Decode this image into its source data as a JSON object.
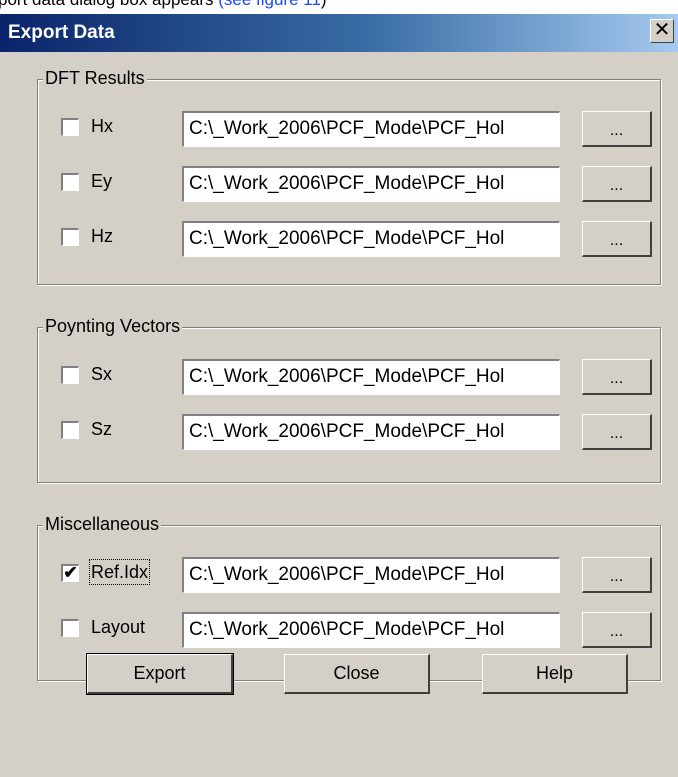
{
  "doc": {
    "text_before": "port data dialog box appears ",
    "link_text": "(see figure 11",
    "text_after": ")"
  },
  "window": {
    "title": "Export Data",
    "close_label": "✕"
  },
  "groups": {
    "dft": {
      "label": "DFT Results",
      "rows": [
        {
          "label": "Hx",
          "checked": false,
          "path": "C:\\_Work_2006\\PCF_Mode\\PCF_Hol",
          "browse": "..."
        },
        {
          "label": "Ey",
          "checked": false,
          "path": "C:\\_Work_2006\\PCF_Mode\\PCF_Hol",
          "browse": "..."
        },
        {
          "label": "Hz",
          "checked": false,
          "path": "C:\\_Work_2006\\PCF_Mode\\PCF_Hol",
          "browse": "..."
        }
      ]
    },
    "poynting": {
      "label": "Poynting Vectors",
      "rows": [
        {
          "label": "Sx",
          "checked": false,
          "path": "C:\\_Work_2006\\PCF_Mode\\PCF_Hol",
          "browse": "..."
        },
        {
          "label": "Sz",
          "checked": false,
          "path": "C:\\_Work_2006\\PCF_Mode\\PCF_Hol",
          "browse": "..."
        }
      ]
    },
    "misc": {
      "label": "Miscellaneous",
      "rows": [
        {
          "label": "Ref.Idx",
          "checked": true,
          "path": "C:\\_Work_2006\\PCF_Mode\\PCF_Hol",
          "browse": "..."
        },
        {
          "label": "Layout",
          "checked": false,
          "path": "C:\\_Work_2006\\PCF_Mode\\PCF_Hol",
          "browse": "..."
        }
      ]
    }
  },
  "buttons": {
    "export": "Export",
    "close": "Close",
    "help": "Help"
  },
  "check_mark": "✔"
}
